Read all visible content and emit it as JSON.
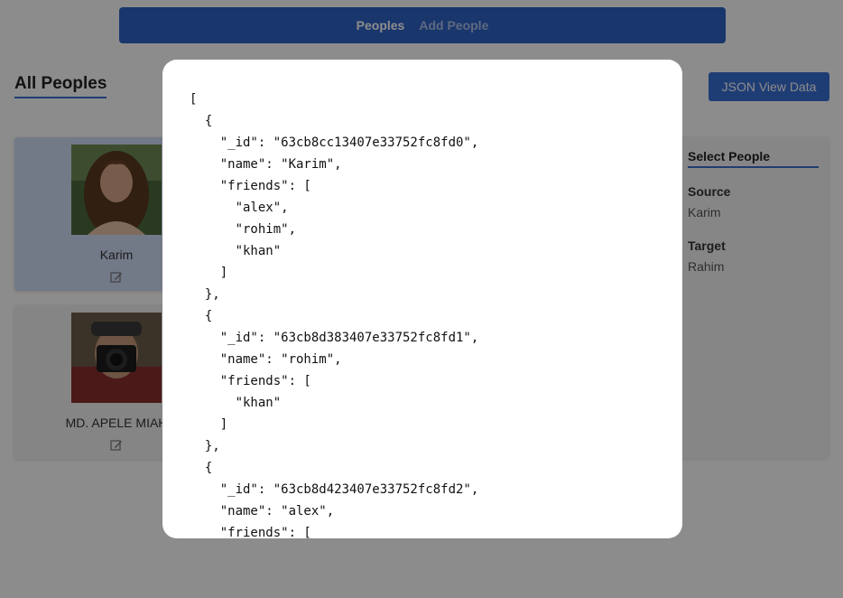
{
  "nav": {
    "items": [
      {
        "label": "Peoples",
        "active": true
      },
      {
        "label": "Add People",
        "active": false
      }
    ]
  },
  "page": {
    "title": "All Peoples"
  },
  "toolbar": {
    "json_button_label": "JSON View Data"
  },
  "cards": [
    {
      "name": "Karim",
      "edit_icon": "edit-icon"
    },
    {
      "name": "MD. APELE MIAH",
      "edit_icon": "edit-icon"
    }
  ],
  "panel": {
    "title": "Select People",
    "source_label": "Source",
    "source_value": "Karim",
    "target_label": "Target",
    "target_value": "Rahim"
  },
  "modal": {
    "json_text": "[\n  {\n    \"_id\": \"63cb8cc13407e33752fc8fd0\",\n    \"name\": \"Karim\",\n    \"friends\": [\n      \"alex\",\n      \"rohim\",\n      \"khan\"\n    ]\n  },\n  {\n    \"_id\": \"63cb8d383407e33752fc8fd1\",\n    \"name\": \"rohim\",\n    \"friends\": [\n      \"khan\"\n    ]\n  },\n  {\n    \"_id\": \"63cb8d423407e33752fc8fd2\",\n    \"name\": \"alex\",\n    \"friends\": ["
  },
  "colors": {
    "nav_bg": "#2f63c7",
    "accent": "#3a6fd6",
    "card_selected_bg": "#cfdcf6",
    "overlay": "rgba(0,0,0,0.45)"
  }
}
